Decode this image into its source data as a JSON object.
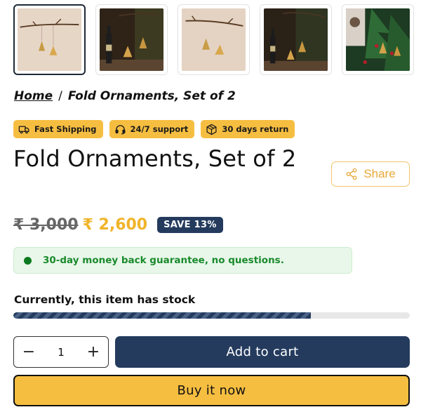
{
  "gallery": {
    "thumbnails": [
      {
        "alt": "ornaments-on-branch-beige"
      },
      {
        "alt": "ornaments-with-bottle-dark"
      },
      {
        "alt": "ornaments-on-branch-beige-2"
      },
      {
        "alt": "ornaments-with-bottle-dark-2"
      },
      {
        "alt": "ornaments-on-christmas-tree"
      }
    ]
  },
  "breadcrumb": {
    "home": "Home",
    "separator": "/",
    "current": "Fold Ornaments, Set of 2"
  },
  "badges": [
    {
      "label": "Fast Shipping",
      "icon": "truck-icon"
    },
    {
      "label": "24/7 support",
      "icon": "headset-icon"
    },
    {
      "label": "30 days return",
      "icon": "box-icon"
    }
  ],
  "product": {
    "title": "Fold Ornaments, Set of 2",
    "share_label": "Share",
    "old_price": "₹ 3,000",
    "new_price": "₹ 2,600",
    "save_label": "SAVE 13%",
    "guarantee": "30-day money back guarantee, no questions.",
    "stock_label": "Currently, this item has stock",
    "stock_level": 0.75,
    "quantity": "1",
    "qty_minus": "−",
    "qty_plus": "+",
    "add_to_cart": "Add to cart",
    "buy_now": "Buy it now"
  },
  "colors": {
    "brand_navy": "#243b5e",
    "accent_yellow": "#f6be41",
    "price_yellow": "#f0b429",
    "success_green": "#1a8a2b"
  }
}
